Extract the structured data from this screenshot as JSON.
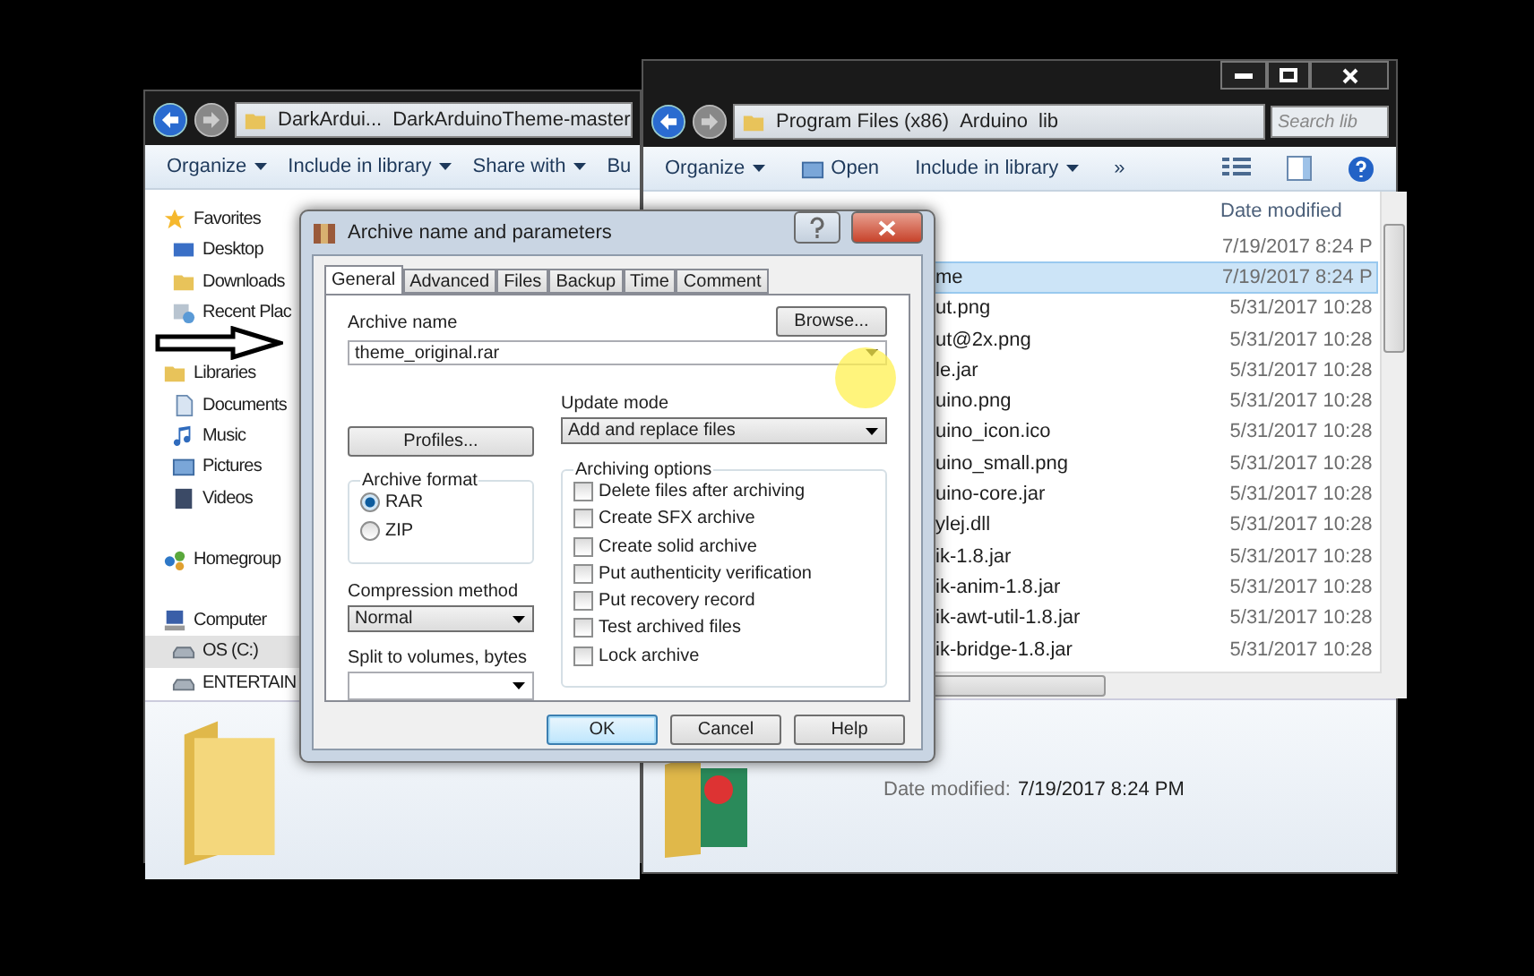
{
  "left_window": {
    "breadcrumb": [
      "DarkArdui...",
      "DarkArduinoTheme-master"
    ],
    "toolbar": [
      {
        "label": "Organize",
        "dropdown": true
      },
      {
        "label": "Include in library",
        "dropdown": true
      },
      {
        "label": "Share with",
        "dropdown": true
      },
      {
        "label": "Bu",
        "dropdown": false
      }
    ],
    "nav": [
      {
        "label": "Favorites",
        "selected": false,
        "children": [
          {
            "label": "Desktop",
            "selected": false
          },
          {
            "label": "Downloads",
            "selected": false
          },
          {
            "label": "Recent Plac",
            "selected": false
          }
        ]
      },
      {
        "label": "Libraries",
        "selected": false,
        "children": [
          {
            "label": "Documents",
            "selected": false
          },
          {
            "label": "Music",
            "selected": false
          },
          {
            "label": "Pictures",
            "selected": false
          },
          {
            "label": "Videos",
            "selected": false
          }
        ]
      },
      {
        "label": "Homegroup",
        "selected": false
      },
      {
        "label": "Computer",
        "selected": false,
        "children": [
          {
            "label": "OS (C:)",
            "selected": true
          },
          {
            "label": "ENTERTAIN",
            "selected": false
          }
        ]
      }
    ]
  },
  "right_window": {
    "breadcrumb": [
      "Program Files (x86)",
      "Arduino",
      "lib"
    ],
    "search": {
      "placeholder": "Search lib"
    },
    "toolbar": [
      {
        "label": "Organize",
        "kind": "dropdown"
      },
      {
        "label": "Open",
        "kind": "icon"
      },
      {
        "label": "Include in library",
        "kind": "dropdown"
      },
      {
        "label": "»",
        "kind": "more"
      }
    ],
    "columns": [
      "Date modified"
    ],
    "rows": [
      {
        "date": "7/19/2017 8:24 P",
        "selected": false
      },
      {
        "name": "me",
        "date": "7/19/2017 8:24 P",
        "selected": true
      },
      {
        "name": "ut.png",
        "date": "5/31/2017 10:28",
        "selected": false
      },
      {
        "name": "ut@2x.png",
        "date": "5/31/2017 10:28",
        "selected": false
      },
      {
        "name": "le.jar",
        "date": "5/31/2017 10:28",
        "selected": false
      },
      {
        "name": "uino.png",
        "date": "5/31/2017 10:28",
        "selected": false
      },
      {
        "name": "uino_icon.ico",
        "date": "5/31/2017 10:28",
        "selected": false
      },
      {
        "name": "uino_small.png",
        "date": "5/31/2017 10:28",
        "selected": false
      },
      {
        "name": "uino-core.jar",
        "date": "5/31/2017 10:28",
        "selected": false
      },
      {
        "name": "ylej.dll",
        "date": "5/31/2017 10:28",
        "selected": false
      },
      {
        "name": "ik-1.8.jar",
        "date": "5/31/2017 10:28",
        "selected": false
      },
      {
        "name": "ik-anim-1.8.jar",
        "date": "5/31/2017 10:28",
        "selected": false
      },
      {
        "name": "ik-awt-util-1.8.jar",
        "date": "5/31/2017 10:28",
        "selected": false
      },
      {
        "name": "ik-bridge-1.8.jar",
        "date": "5/31/2017 10:28",
        "selected": false
      }
    ],
    "details": {
      "label": "Date modified:",
      "value": "7/19/2017 8:24 PM"
    }
  },
  "dialog": {
    "title": "Archive name and parameters",
    "tabs": [
      {
        "label": "General",
        "selected": true
      },
      {
        "label": "Advanced",
        "selected": false
      },
      {
        "label": "Files",
        "selected": false
      },
      {
        "label": "Backup",
        "selected": false
      },
      {
        "label": "Time",
        "selected": false
      },
      {
        "label": "Comment",
        "selected": false
      }
    ],
    "archive_name": {
      "label": "Archive name",
      "value": "theme_original.rar"
    },
    "browse": "Browse...",
    "profiles": "Profiles...",
    "update_mode": {
      "label": "Update mode",
      "value": "Add and replace files"
    },
    "archive_format": {
      "label": "Archive format",
      "options": [
        {
          "label": "RAR",
          "selected": true
        },
        {
          "label": "ZIP",
          "selected": false
        }
      ]
    },
    "compression": {
      "label": "Compression method",
      "value": "Normal"
    },
    "split": {
      "label": "Split to volumes, bytes"
    },
    "options": {
      "label": "Archiving options",
      "items": [
        {
          "label": "Delete files after archiving",
          "checked": false
        },
        {
          "label": "Create SFX archive",
          "checked": false
        },
        {
          "label": "Create solid archive",
          "checked": false
        },
        {
          "label": "Put authenticity verification",
          "checked": false
        },
        {
          "label": "Put recovery record",
          "checked": false
        },
        {
          "label": "Test archived files",
          "checked": false
        },
        {
          "label": "Lock archive",
          "checked": false
        }
      ]
    },
    "buttons": [
      {
        "label": "OK",
        "default": true
      },
      {
        "label": "Cancel",
        "default": false
      },
      {
        "label": "Help",
        "default": false
      }
    ]
  }
}
